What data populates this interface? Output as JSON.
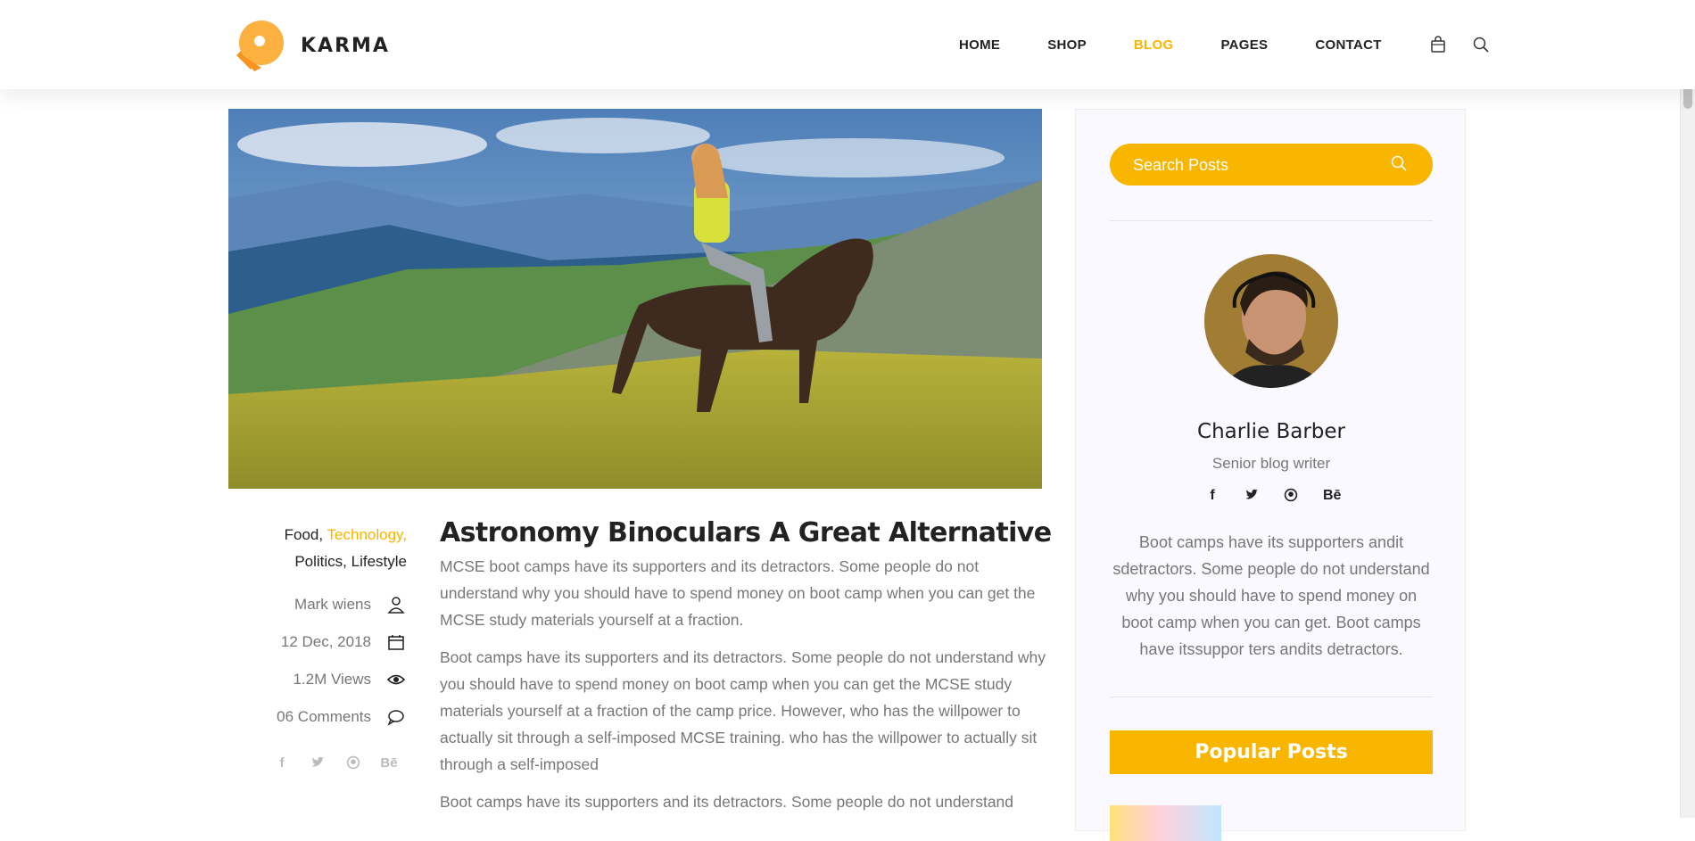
{
  "brand": {
    "name": "KARMA",
    "accent": "#f8b600"
  },
  "nav": {
    "items": [
      {
        "label": "HOME",
        "active": false
      },
      {
        "label": "SHOP",
        "active": false
      },
      {
        "label": "BLOG",
        "active": true
      },
      {
        "label": "PAGES",
        "active": false
      },
      {
        "label": "CONTACT",
        "active": false
      }
    ],
    "icons": [
      "cart-icon",
      "search-icon"
    ]
  },
  "post": {
    "categories": {
      "c1": "Food,",
      "c2": "Technology,",
      "c3": "Politics,",
      "c4": "Lifestyle"
    },
    "author": "Mark wiens",
    "date": "12 Dec, 2018",
    "views": "1.2M Views",
    "comments": "06 Comments",
    "share_icons": [
      "facebook-icon",
      "twitter-icon",
      "github-icon",
      "behance-icon"
    ],
    "title": "Astronomy Binoculars A Great Alternative",
    "paragraphs": [
      "MCSE boot camps have its supporters and its detractors. Some people do not understand why you should have to spend money on boot camp when you can get the MCSE study materials yourself at a fraction.",
      "Boot camps have its supporters and its detractors. Some people do not understand why you should have to spend money on boot camp when you can get the MCSE study materials yourself at a fraction of the camp price. However, who has the willpower to actually sit through a self-imposed MCSE training. who has the willpower to actually sit through a self-imposed",
      "Boot camps have its supporters and its detractors. Some people do not understand"
    ]
  },
  "sidebar": {
    "search_placeholder": "Search Posts",
    "author_name": "Charlie Barber",
    "author_role": "Senior blog writer",
    "author_social": [
      "facebook-icon",
      "twitter-icon",
      "github-icon",
      "behance-icon"
    ],
    "author_bio": "Boot camps have its supporters andit sdetractors. Some people do not understand why you should have to spend money on boot camp when you can get. Boot camps have itssuppor ters andits detractors.",
    "popular_title": "Popular Posts"
  }
}
